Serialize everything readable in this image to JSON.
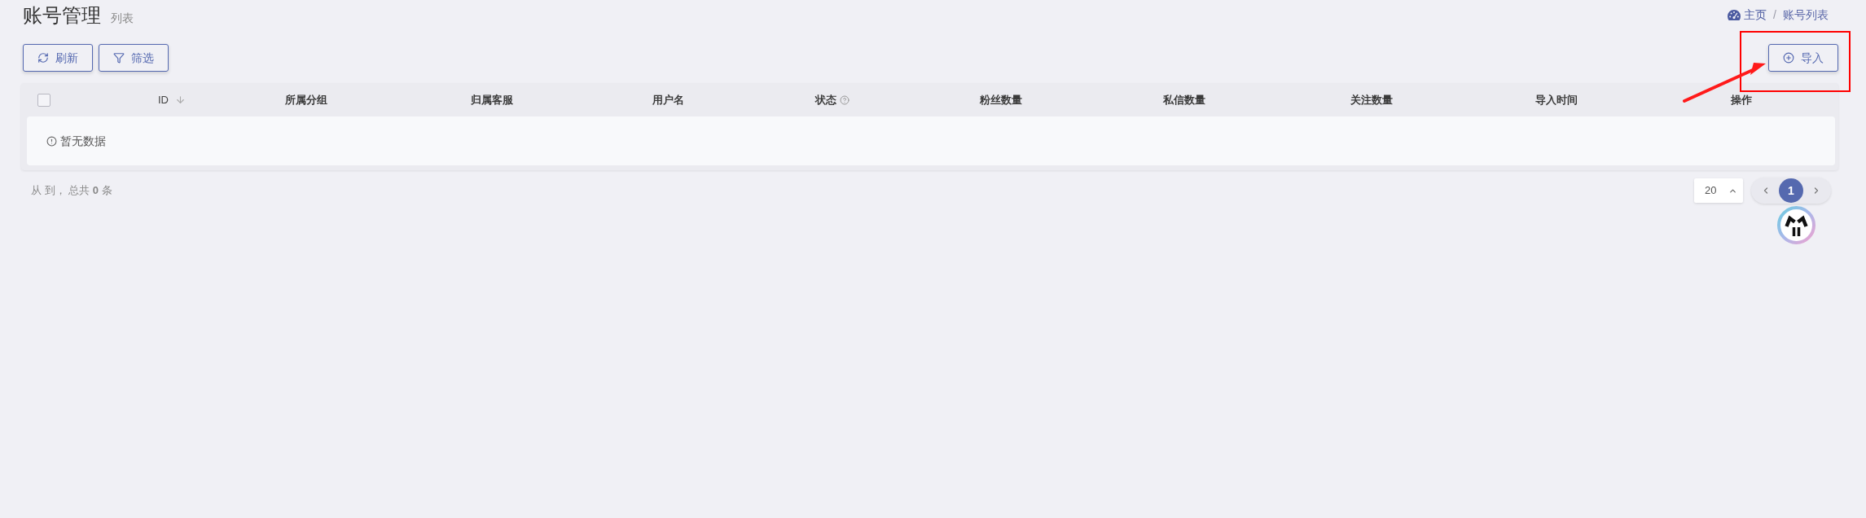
{
  "page_header": {
    "title": "账号管理",
    "subtitle": "列表"
  },
  "breadcrumb": {
    "separator": "/",
    "items": [
      {
        "label": "主页",
        "kind": "home"
      },
      {
        "label": "账号列表",
        "kind": "page"
      }
    ]
  },
  "toolbar": {
    "left": [
      {
        "label": "刷新",
        "kind": "refresh"
      },
      {
        "label": "筛选",
        "kind": "filter"
      }
    ],
    "right": [
      {
        "label": "导入",
        "kind": "import"
      }
    ]
  },
  "table": {
    "select_all": {
      "checked": false
    },
    "columns": [
      {
        "label": "ID",
        "kind": "sort"
      },
      {
        "label": "所属分组",
        "kind": "plain"
      },
      {
        "label": "归属客服",
        "kind": "plain"
      },
      {
        "label": "用户名",
        "kind": "plain"
      },
      {
        "label": "状态",
        "kind": "help"
      },
      {
        "label": "粉丝数量",
        "kind": "plain"
      },
      {
        "label": "私信数量",
        "kind": "plain"
      },
      {
        "label": "关注数量",
        "kind": "plain"
      },
      {
        "label": "导入时间",
        "kind": "plain"
      },
      {
        "label": "操作",
        "kind": "plain"
      }
    ],
    "empty_text": "暂无数据"
  },
  "footer": {
    "summary": "从 到， 总共 **0** 条"
  },
  "pagination": {
    "page_size": "20",
    "pages": [
      {
        "label": "1",
        "selected": true
      }
    ]
  },
  "annotations": [
    {
      "kind": "highlight_box"
    },
    {
      "kind": "arrow"
    }
  ]
}
